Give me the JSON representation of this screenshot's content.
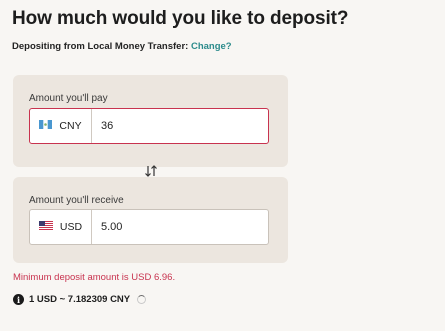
{
  "header": {
    "title": "How much would you like to deposit?",
    "subtitle_prefix": "Depositing from Local Money Transfer:",
    "change_link": "Change?"
  },
  "pay": {
    "label": "Amount you'll pay",
    "currency_code": "CNY",
    "currency_icon": "guatemala-flag-icon",
    "value": "36"
  },
  "receive": {
    "label": "Amount you'll receive",
    "currency_code": "USD",
    "currency_icon": "us-flag-icon",
    "value": "5.00"
  },
  "swap_icon": "swap-arrows-icon",
  "error_text": "Minimum deposit amount is USD 6.96.",
  "rate": {
    "icon": "info-icon",
    "text": "1 USD ~ 7.182309 CNY",
    "loading_icon": "spinner-icon"
  },
  "colors": {
    "error": "#c8334f",
    "link": "#2c8b8b",
    "panel_bg": "#ece6df",
    "page_bg": "#f8f6f3"
  }
}
